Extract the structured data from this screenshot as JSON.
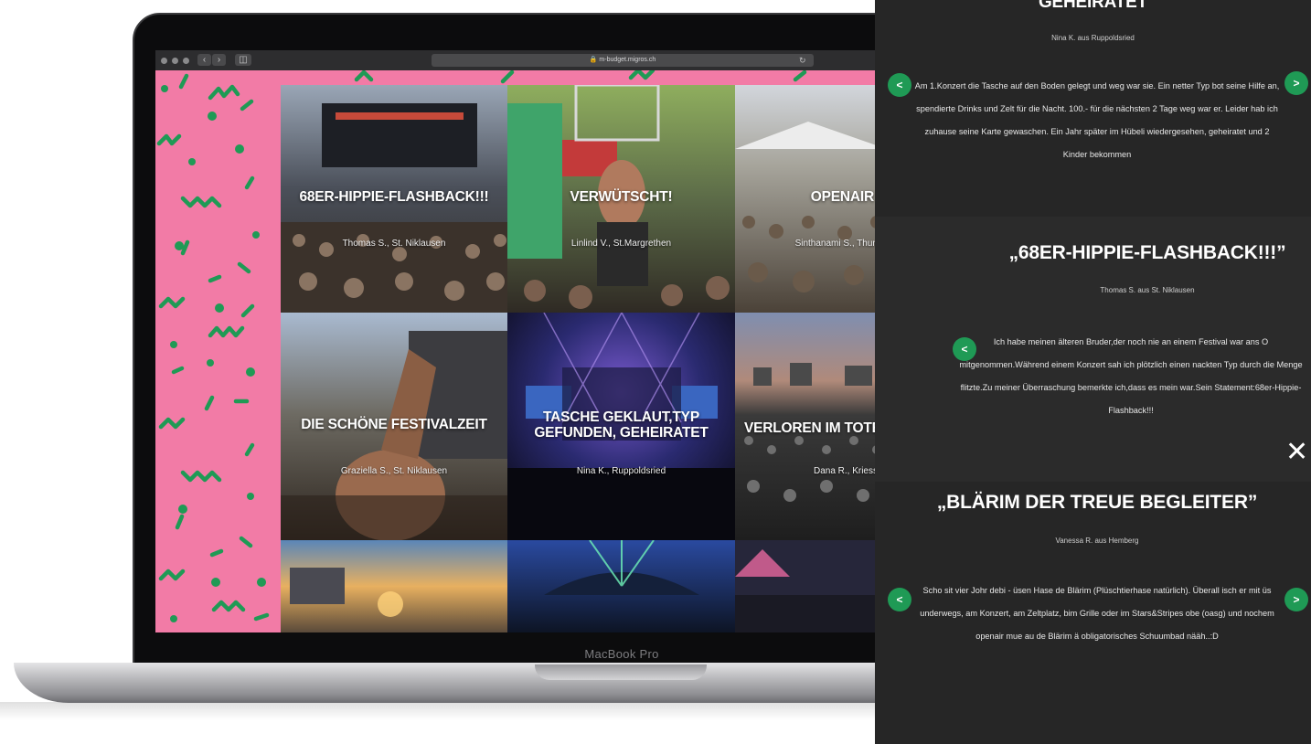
{
  "browser": {
    "url": "m-budget.migros.ch",
    "back_icon": "chevron-left-icon",
    "forward_icon": "chevron-right-icon"
  },
  "device": {
    "label": "MacBook Pro"
  },
  "grid": {
    "tiles": [
      {
        "title": "68ER-HIPPIE-FLASHBACK!!!",
        "author": "Thomas S., St. Niklausen",
        "colors": [
          "#6e7c8f",
          "#3a3f49",
          "#a08f7e"
        ]
      },
      {
        "title": "VERWÜTSCHT!",
        "author": "Linlind V., St.Margrethen",
        "colors": [
          "#8ca65a",
          "#4a5a3a",
          "#c96a5a"
        ]
      },
      {
        "title": "OPENAIR",
        "author": "Sinthanami S., Thun",
        "colors": [
          "#c8ccd2",
          "#8c8a82",
          "#544c42"
        ]
      },
      {
        "title": "DIE SCHÖNE FESTIVALZEIT",
        "author": "Graziella S., St. Niklausen",
        "colors": [
          "#9cb0c8",
          "#5a5244",
          "#a8745a"
        ]
      },
      {
        "title": "TASCHE GEKLAUT,TYP GEFUNDEN, GEHEIRATET",
        "author": "Nina K., Ruppoldsried",
        "colors": [
          "#2a2a6e",
          "#6a4aa0",
          "#151530"
        ]
      },
      {
        "title": "VERLOREN IM TOTENHOSENMEER",
        "author": "Dana R., Kriess",
        "colors": [
          "#6a7a9a",
          "#8a6a5a",
          "#3a3a3a"
        ]
      },
      {
        "title": "",
        "author": "",
        "colors": [
          "#5a86b8",
          "#f0b04a",
          "#6a5a4a"
        ]
      },
      {
        "title": "",
        "author": "",
        "colors": [
          "#1e3a8a",
          "#3fd0a0",
          "#101a30"
        ]
      },
      {
        "title": "",
        "author": "",
        "colors": [
          "#3a3a5a",
          "#c05a8a",
          "#1a1a2a"
        ]
      }
    ]
  },
  "stories": {
    "top": {
      "title": "GEHEIRATET",
      "author": "Nina K. aus Ruppoldsried",
      "text": "Am 1.Konzert die Tasche auf den Boden gelegt und weg war sie. Ein netter Typ bot seine Hilfe an, spendierte Drinks und Zelt für die Nacht. 100.- für die nächsten 2 Tage weg war er. Leider hab ich zuhause seine Karte gewaschen. Ein Jahr später im Hübeli wiedergesehen, geheiratet und 2 Kinder bekommen",
      "prev_icon": "chevron-left-icon",
      "next_icon": "chevron-right-icon"
    },
    "middle": {
      "title": "„68ER-HIPPIE-FLASHBACK!!!”",
      "author": "Thomas S. aus St. Niklausen",
      "text": "Ich habe meinen älteren Bruder,der noch nie an einem Festival war ans O mitgenommen.Während einem Konzert sah ich plötzlich einen nackten Typ durch die Menge flitzte.Zu meiner Überraschung bemerkte ich,dass es mein war.Sein Statement:68er-Hippie-Flashback!!!",
      "prev_icon": "chevron-left-icon",
      "close_icon": "close-icon"
    },
    "bottom": {
      "title": "„BLÄRIM DER TREUE BEGLEITER”",
      "author": "Vanessa R. aus Hemberg",
      "text": "Scho sit vier Johr debi - üsen Hase de Blärim (Plüschtierhase natürlich). Überall isch er mit üs underwegs, am Konzert, am Zeltplatz, bim Grille oder im Stars&Stripes obe (oasg) und nochem openair mue au de Blärim ä obligatorisches Schuumbad nääh..:D",
      "prev_icon": "chevron-left-icon",
      "next_icon": "chevron-right-icon"
    }
  },
  "colors": {
    "pink": "#f27ba6",
    "green": "#1f9a55",
    "panel": "#262626"
  }
}
